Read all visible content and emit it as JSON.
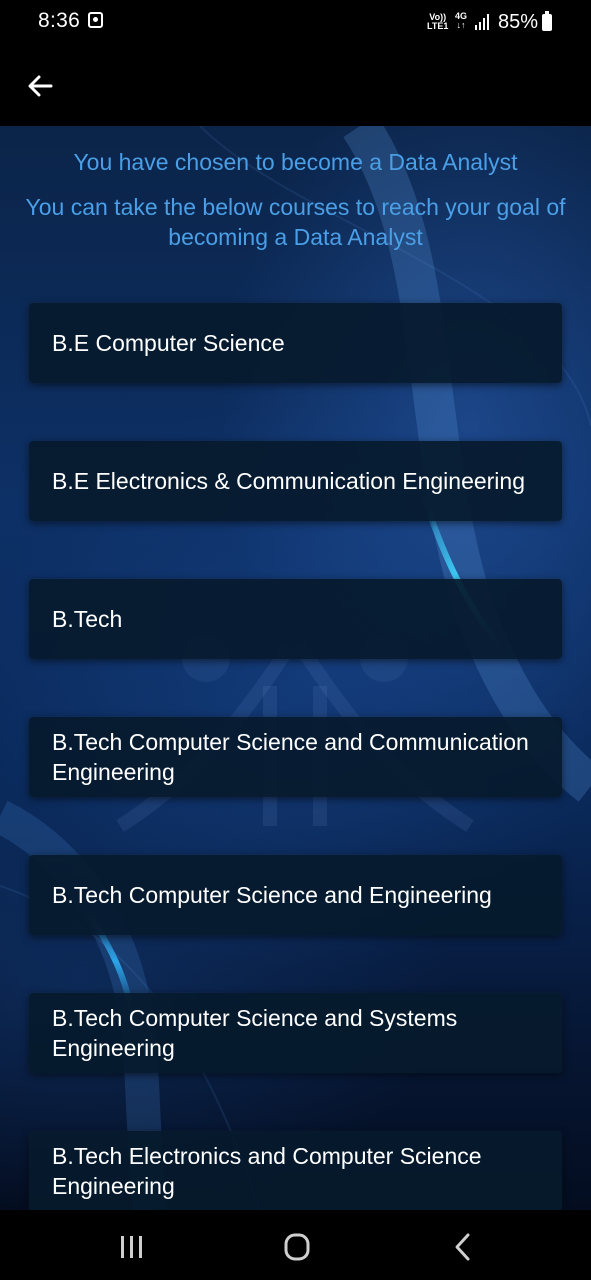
{
  "status_bar": {
    "time": "8:36",
    "volte_top": "Vo))",
    "volte_bottom": "LTE1",
    "network_top": "4G",
    "network_bottom": "↓↑",
    "battery_percent": "85%",
    "icons": [
      "notification-icon",
      "volte-icon",
      "network-4g-icon",
      "signal-icon",
      "battery-icon"
    ]
  },
  "app_bar": {
    "back_icon": "arrow-left-icon"
  },
  "header": {
    "line1": "You have chosen to become a Data Analyst",
    "line2": "You can take the below courses to reach your goal of becoming a Data Analyst"
  },
  "courses": [
    {
      "label": "B.E Computer Science"
    },
    {
      "label": "B.E Electronics & Communication Engineering"
    },
    {
      "label": "B.Tech"
    },
    {
      "label": "B.Tech Computer Science and Communication Engineering"
    },
    {
      "label": "B.Tech Computer Science and Engineering"
    },
    {
      "label": "B.Tech Computer Science and Systems Engineering"
    },
    {
      "label": "B.Tech Electronics and Computer Science Engineering"
    }
  ],
  "nav_bar": {
    "icons": [
      "recents-icon",
      "home-icon",
      "back-icon"
    ]
  },
  "colors": {
    "header_text": "#4a9fe6",
    "card_background": "#071a2c",
    "card_text": "#ffffff",
    "background_top": "#0b2449",
    "background_bottom": "#040d20",
    "accent_glow": "#3fd6ff"
  }
}
